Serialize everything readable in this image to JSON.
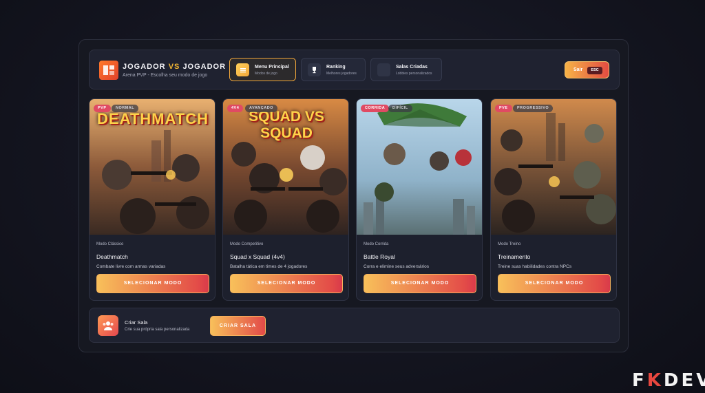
{
  "header": {
    "title_left": "JOGADOR",
    "title_vs": "VS",
    "title_right": "JOGADOR",
    "subtitle": "Arena PVP - Escolha seu modo de jogo",
    "nav": [
      {
        "label": "Menu Principal",
        "sub": "Modos de jogo",
        "icon": "menu-icon",
        "active": true
      },
      {
        "label": "Ranking",
        "sub": "Melhores jogadores",
        "icon": "trophy-icon",
        "active": false
      },
      {
        "label": "Salas Criadas",
        "sub": "Lobbies personalizados",
        "icon": "lobby-icon",
        "active": false
      }
    ],
    "exit_label": "Sair",
    "exit_key": "ESC"
  },
  "cards": [
    {
      "tag_a": "PVP",
      "tag_b": "NORMAL",
      "art_title": "DEATHMATCH",
      "category": "Modo Clássico",
      "name": "Deathmatch",
      "desc": "Combate livre com armas variadas",
      "button": "SELECIONAR MODO"
    },
    {
      "tag_a": "4V4",
      "tag_b": "AVANÇADO",
      "art_title": "SQUAD VS SQUAD",
      "category": "Modo Competitivo",
      "name": "Squad x Squad (4v4)",
      "desc": "Batalha tática em times de 4 jogadores",
      "button": "SELECIONAR MODO"
    },
    {
      "tag_a": "CORRIDA",
      "tag_b": "DIFÍCIL",
      "art_title": "",
      "category": "Modo Corrida",
      "name": "Battle Royal",
      "desc": "Corra e elimine seus adversários",
      "button": "SELECIONAR MODO"
    },
    {
      "tag_a": "PVE",
      "tag_b": "PROGRESSIVO",
      "art_title": "",
      "category": "Modo Treino",
      "name": "Treinamento",
      "desc": "Treine suas habilidades contra NPCs",
      "button": "SELECIONAR MODO"
    }
  ],
  "create_room": {
    "title": "Criar Sala",
    "subtitle": "Crie sua própria sala personalizada",
    "button": "CRIAR SALA"
  },
  "watermark": {
    "left": "F",
    "k": "K",
    "right": "DEV"
  },
  "colors": {
    "accent_orange": "#f8c05a",
    "accent_red": "#e34c48",
    "tag_red": "#e04a63",
    "panel": "#161821"
  }
}
